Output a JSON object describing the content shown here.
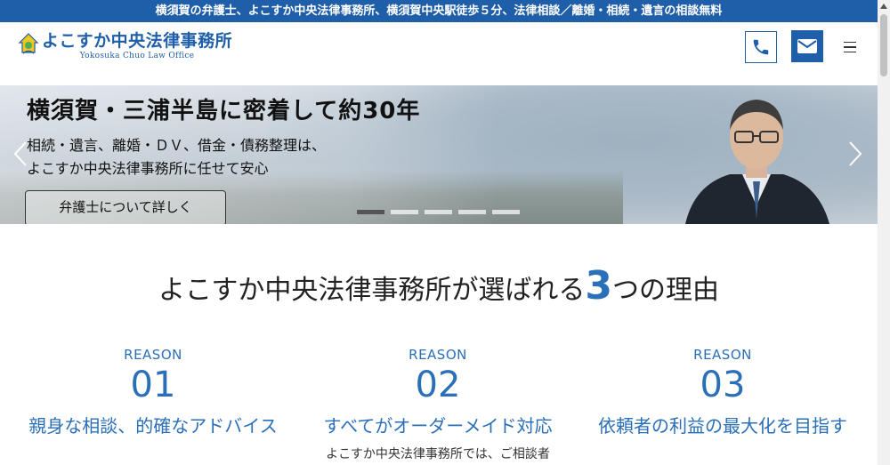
{
  "topbar": {
    "text": "横須賀の弁護士、よこすか中央法律事務所、横須賀中央駅徒歩５分、法律相談／離婚・相続・遺言の相談無料"
  },
  "header": {
    "logo_main": "よこすか中央法律事務所",
    "logo_sub": "Yokosuka Chuo Law Office",
    "phone_icon": "phone-icon",
    "mail_icon": "mail-icon",
    "menu_icon": "hamburger-menu-icon"
  },
  "hero": {
    "title": "横須賀・三浦半島に密着して約30年",
    "lead_line1": "相続・遺言、離婚・ＤＶ、借金・債務整理は、",
    "lead_line2": "よこすか中央法律事務所に任せて安心",
    "button_label": "弁護士について詳しく",
    "slide_count": 5,
    "active_slide": 1
  },
  "reasons": {
    "title_before": "よこすか中央法律事務所が選ばれる",
    "title_number": "3",
    "title_after": "つの理由",
    "items": [
      {
        "label": "REASON",
        "number": "01",
        "heading": "親身な相談、的確なアドバイス",
        "body": ""
      },
      {
        "label": "REASON",
        "number": "02",
        "heading": "すべてがオーダーメイド対応",
        "body": "よこすか中央法律事務所では、ご相談者"
      },
      {
        "label": "REASON",
        "number": "03",
        "heading": "依頼者の利益の最大化を目指す",
        "body": ""
      }
    ]
  },
  "colors": {
    "brand": "#1f5ea8",
    "accent": "#2a6fb8"
  }
}
